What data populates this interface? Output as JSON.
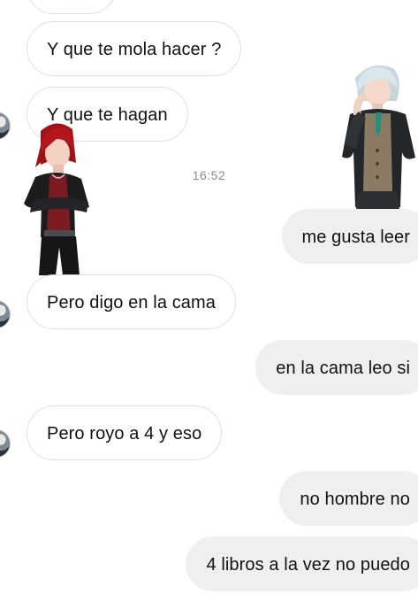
{
  "chat": {
    "timestamp": "16:52",
    "messages": [
      {
        "id": "m0",
        "direction": "incoming",
        "text": ""
      },
      {
        "id": "m1",
        "direction": "incoming",
        "text": "Y que te mola hacer ?"
      },
      {
        "id": "m2",
        "direction": "incoming",
        "text": "Y que te hagan"
      },
      {
        "id": "m3",
        "direction": "outgoing",
        "text": "me gusta leer"
      },
      {
        "id": "m4",
        "direction": "incoming",
        "text": "Pero digo en la cama"
      },
      {
        "id": "m5",
        "direction": "outgoing",
        "text": "en la cama leo si"
      },
      {
        "id": "m6",
        "direction": "incoming",
        "text": "Pero royo a 4 y eso"
      },
      {
        "id": "m7",
        "direction": "outgoing",
        "text": "no hombre no"
      },
      {
        "id": "m8",
        "direction": "outgoing",
        "text": "4 libros a la vez no puedo"
      }
    ]
  },
  "stickers": [
    {
      "name": "red-haired-character-sticker",
      "hair": "#b3161d",
      "jacket": "#1c1c1f",
      "shirt": "#7b1b22"
    },
    {
      "name": "silver-haired-character-sticker",
      "hair": "#d9e6ea",
      "jacket": "#24272a",
      "vest": "#8b7b64",
      "tie": "#1f8f80"
    }
  ],
  "colors": {
    "background": "#ffffff",
    "incoming_bubble_border": "#dfdfdf",
    "outgoing_bubble": "#efefef",
    "timestamp": "#8a8a8a",
    "text": "#111111"
  }
}
